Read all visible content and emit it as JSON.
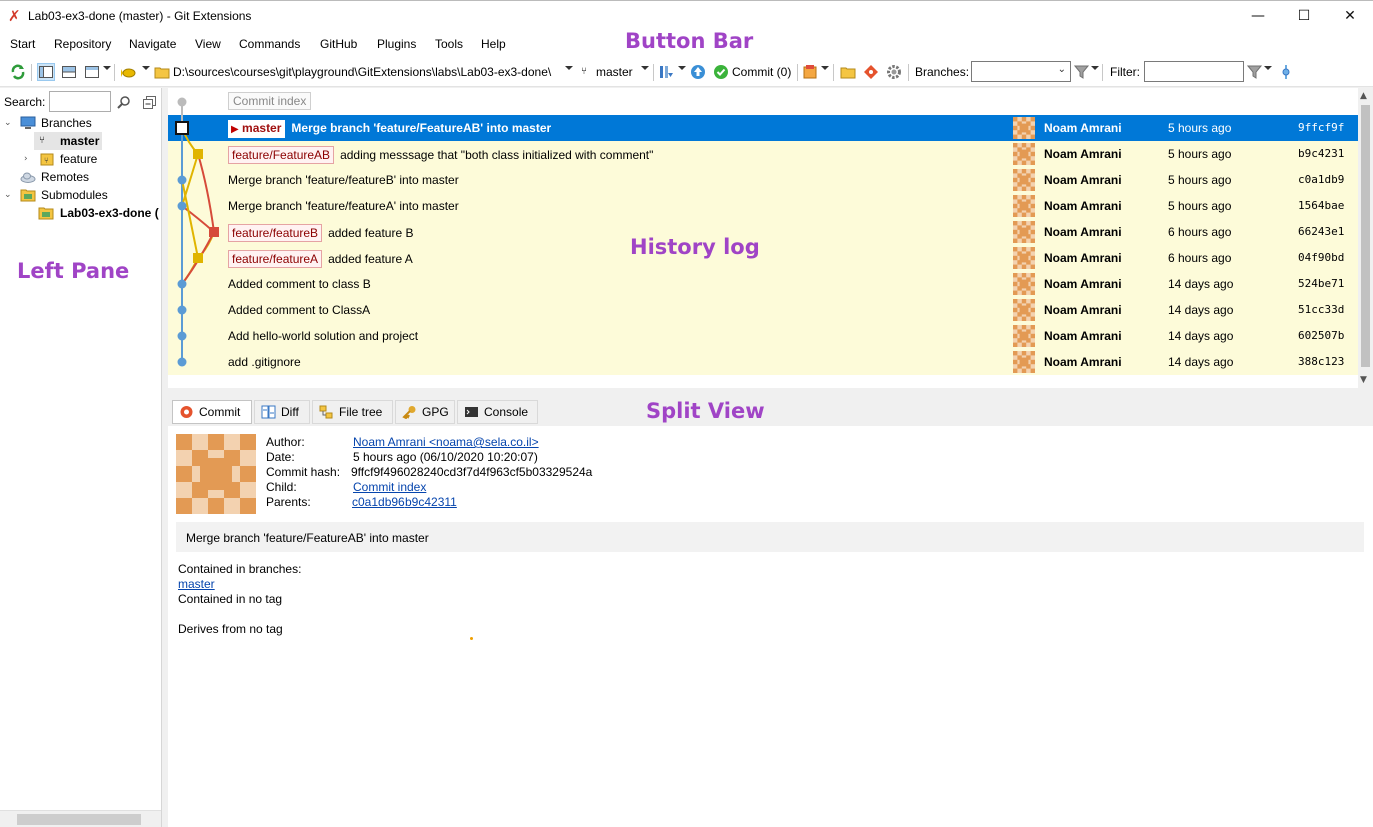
{
  "window": {
    "title": "Lab03-ex3-done (master) - Git Extensions",
    "minimize": "—",
    "maximize": "☐",
    "close": "✕"
  },
  "menu": [
    "Start",
    "Repository",
    "Navigate",
    "View",
    "Commands",
    "GitHub",
    "Plugins",
    "Tools",
    "Help"
  ],
  "toolbar": {
    "path": "D:\\sources\\courses\\git\\playground\\GitExtensions\\labs\\Lab03-ex3-done\\",
    "branch": "master",
    "commit_label": "Commit (0)",
    "branches_label": "Branches:",
    "filter_label": "Filter:"
  },
  "annotations": {
    "button_bar": "Button Bar",
    "history_log": "History log",
    "left_pane": "Left Pane",
    "split_view": "Split View"
  },
  "left_pane": {
    "search_label": "Search:",
    "tree": {
      "branches": "Branches",
      "master": "master",
      "feature": "feature",
      "remotes": "Remotes",
      "submodules": "Submodules",
      "submodule_item": "Lab03-ex3-done ("
    }
  },
  "history": {
    "commit_index_label": "Commit index",
    "commits": [
      {
        "refs": [
          "master"
        ],
        "head": true,
        "message": "Merge branch 'feature/FeatureAB' into master",
        "author": "Noam Amrani",
        "date": "5 hours ago",
        "hash": "9ffcf9f"
      },
      {
        "refs": [
          "feature/FeatureAB"
        ],
        "message": "adding messsage that \"both class initialized with comment\"",
        "author": "Noam Amrani",
        "date": "5 hours ago",
        "hash": "b9c4231"
      },
      {
        "refs": [],
        "message": "Merge branch 'feature/featureB' into master",
        "author": "Noam Amrani",
        "date": "5 hours ago",
        "hash": "c0a1db9"
      },
      {
        "refs": [],
        "message": "Merge branch 'feature/featureA' into master",
        "author": "Noam Amrani",
        "date": "5 hours ago",
        "hash": "1564bae"
      },
      {
        "refs": [
          "feature/featureB"
        ],
        "message": "added feature B",
        "author": "Noam Amrani",
        "date": "6 hours ago",
        "hash": "66243e1"
      },
      {
        "refs": [
          "feature/featureA"
        ],
        "message": "added feature A",
        "author": "Noam Amrani",
        "date": "6 hours ago",
        "hash": "04f90bd"
      },
      {
        "refs": [],
        "message": "Added comment to class B",
        "author": "Noam Amrani",
        "date": "14 days ago",
        "hash": "524be71"
      },
      {
        "refs": [],
        "message": "Added comment to ClassA",
        "author": "Noam Amrani",
        "date": "14 days ago",
        "hash": "51cc33d"
      },
      {
        "refs": [],
        "message": "Add hello-world solution and project",
        "author": "Noam Amrani",
        "date": "14 days ago",
        "hash": "602507b"
      },
      {
        "refs": [],
        "message": "add .gitignore",
        "author": "Noam Amrani",
        "date": "14 days ago",
        "hash": "388c123"
      }
    ]
  },
  "tabs": [
    "Commit",
    "Diff",
    "File tree",
    "GPG",
    "Console"
  ],
  "details": {
    "author_label": "Author:",
    "author_value": "Noam Amrani <noama@sela.co.il>",
    "date_label": "Date:",
    "date_value": "5 hours ago (06/10/2020 10:20:07)",
    "hash_label": "Commit hash:",
    "hash_value": "9ffcf9f496028240cd3f7d4f963cf5b03329524a",
    "child_label": "Child:",
    "child_value": "Commit index",
    "parents_label": "Parents:",
    "parent1": "c0a1db96",
    "parent2": "b9c42311",
    "message": "Merge branch 'feature/FeatureAB' into master",
    "contained_branches_label": "Contained in branches:",
    "contained_branch": "master",
    "contained_tag": "Contained in no tag",
    "derives": "Derives from no tag"
  },
  "colors": {
    "selection": "#0078d7",
    "row_highlight": "#fdfbd9",
    "graph_blue": "#5b9bd5",
    "graph_yellow": "#e0b400",
    "graph_red": "#d64a3a",
    "annotation": "#a044c6"
  }
}
